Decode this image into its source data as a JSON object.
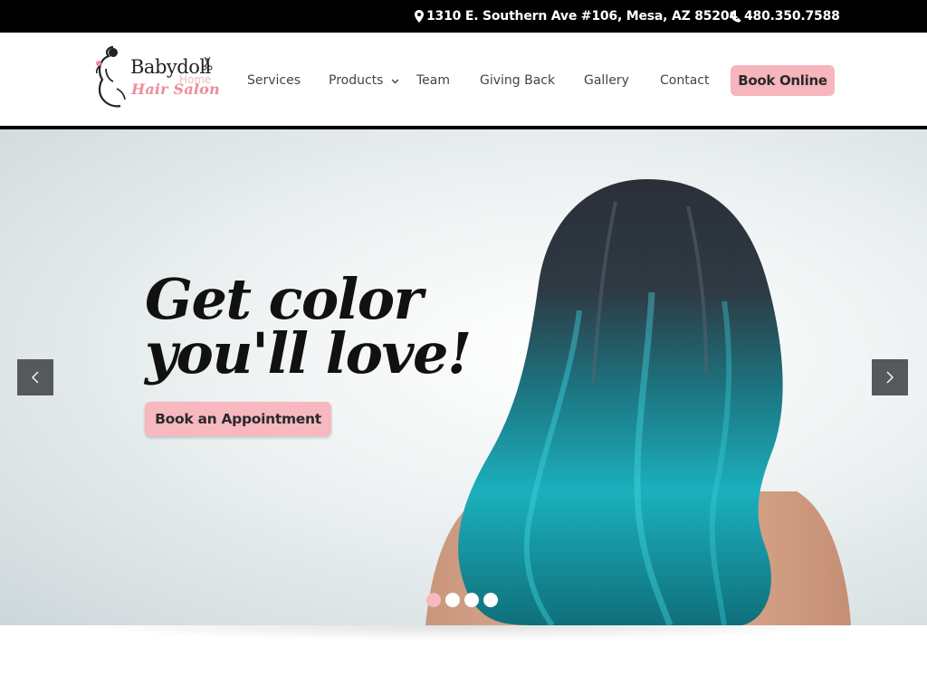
{
  "topbar": {
    "address": "1310 E. Southern Ave #106, Mesa, AZ 85204",
    "phone": "480.350.7588",
    "address_icon": "map-marker-icon",
    "phone_icon": "phone-icon"
  },
  "logo": {
    "line1": "Babydoll",
    "line2": "Hair Salon",
    "ghost_text": "Home"
  },
  "nav": {
    "items": [
      {
        "label": "Services"
      },
      {
        "label": "Products"
      },
      {
        "label": "Team"
      },
      {
        "label": "Giving Back"
      },
      {
        "label": "Gallery"
      },
      {
        "label": "Contact"
      }
    ],
    "cta": "Book Online"
  },
  "hero": {
    "headline_line1": "Get color",
    "headline_line2": "you'll love!",
    "button": "Book an Appointment",
    "slide_count": 4,
    "active_slide": 1
  },
  "colors": {
    "accent_pink": "#f7b8bf",
    "hair_teal": "#1bb7c4",
    "topbar_bg": "#000000"
  }
}
